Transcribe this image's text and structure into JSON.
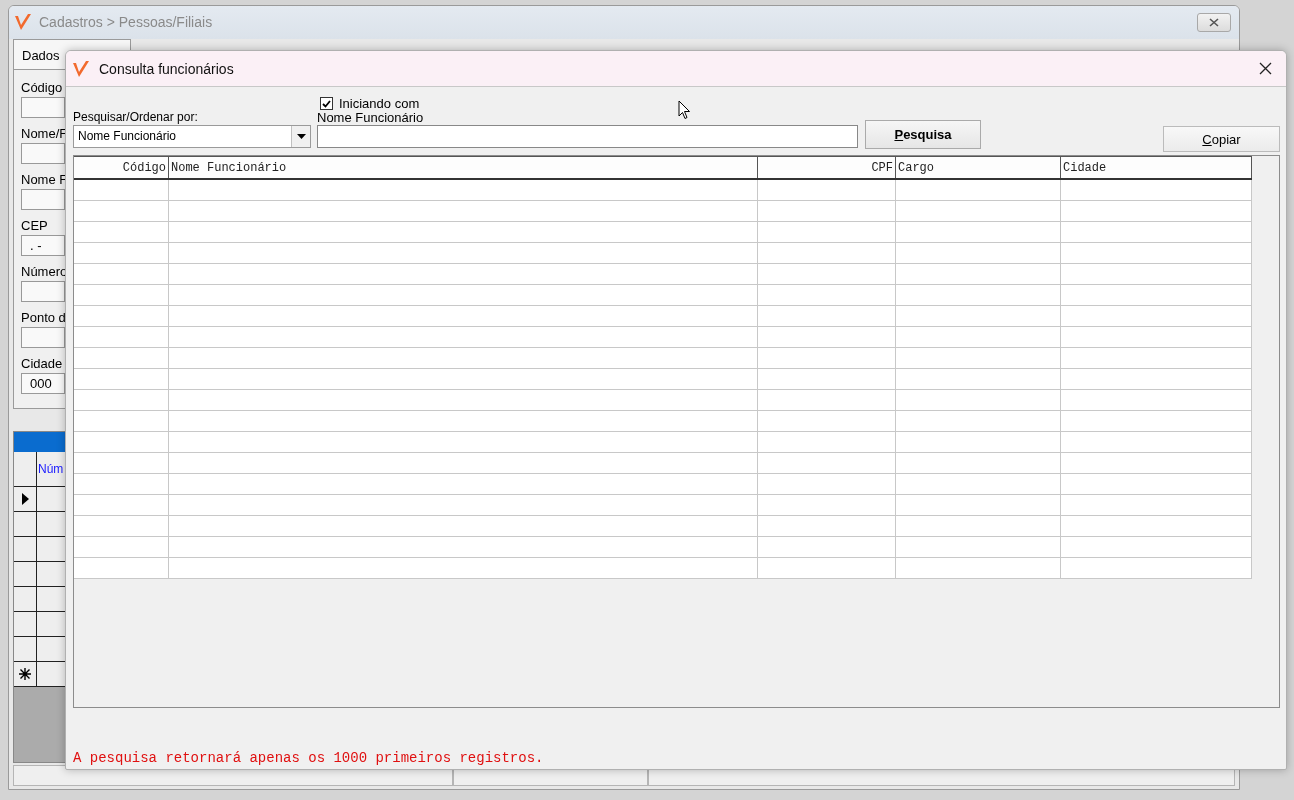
{
  "background_window": {
    "title": "Cadastros > Pessoas/Filiais",
    "tab": "Dados",
    "fields": [
      {
        "label": "Código"
      },
      {
        "label": "Nome/F"
      },
      {
        "label": "Nome F"
      },
      {
        "label": "CEP",
        "value": ". -"
      },
      {
        "label": "Número"
      },
      {
        "label": "Ponto d"
      },
      {
        "label": "Cidade",
        "value": "000"
      }
    ],
    "grid": {
      "column": "Núm",
      "rows": [
        {
          "kind": "current"
        },
        {
          "kind": "blank"
        },
        {
          "kind": "blank"
        },
        {
          "kind": "blank"
        },
        {
          "kind": "blank"
        },
        {
          "kind": "blank"
        },
        {
          "kind": "blank"
        },
        {
          "kind": "new"
        }
      ]
    }
  },
  "dialog": {
    "title": "Consulta funcionários",
    "search_by": {
      "label": "Pesquisar/Ordenar por:",
      "value": "Nome Funcionário"
    },
    "starts_with": {
      "label": "Iniciando com",
      "checked": true
    },
    "search_field": {
      "label": "Nome Funcionário"
    },
    "buttons": [
      {
        "label": "Pesquisa",
        "kind": "search"
      },
      {
        "label": "Copiar",
        "kind": "copy"
      }
    ],
    "table": {
      "columns": [
        {
          "label": "Código"
        },
        {
          "label": "Nome Funcionário"
        },
        {
          "label": "CPF"
        },
        {
          "label": "Cargo"
        },
        {
          "label": "Cidade"
        }
      ]
    },
    "note": "A pesquisa retornará apenas os 1000 primeiros registros."
  }
}
